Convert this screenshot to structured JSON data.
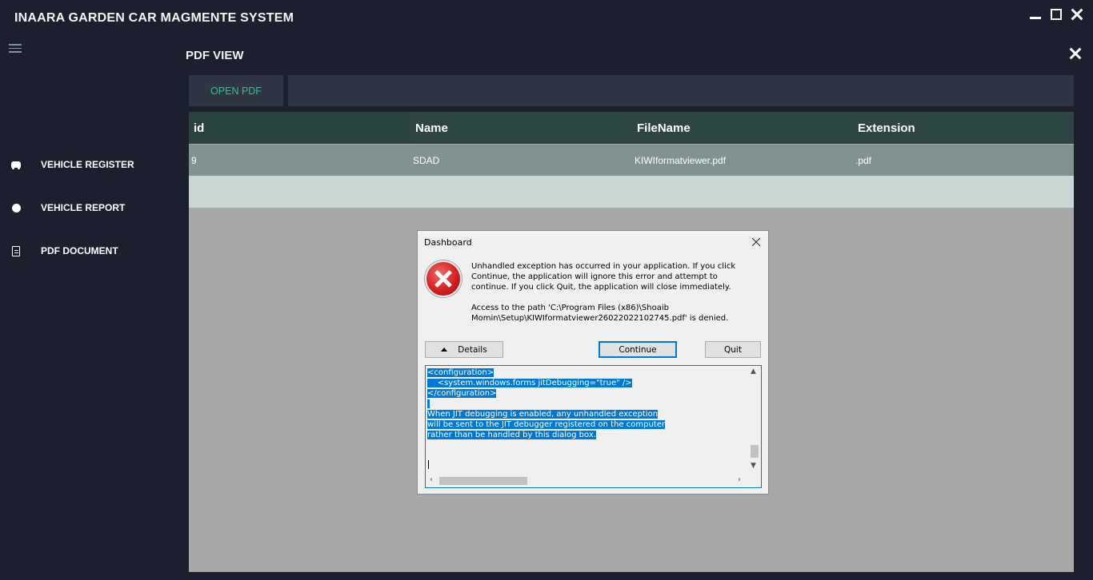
{
  "app": {
    "title": "INAARA GARDEN CAR MAGMENTE SYSTEM"
  },
  "sidebar": {
    "items": [
      {
        "label": "VEHICLE REGISTER",
        "icon": "car-icon"
      },
      {
        "label": "VEHICLE REPORT",
        "icon": "circle-icon"
      },
      {
        "label": "PDF DOCUMENT",
        "icon": "document-icon"
      }
    ]
  },
  "main": {
    "title": "PDF VIEW",
    "open_button": "OPEN PDF",
    "path_value": "",
    "table": {
      "columns": [
        "id",
        "Name",
        "FileName",
        "Extension"
      ],
      "rows": [
        [
          "9",
          "SDAD",
          "KIWIformatviewer.pdf",
          ".pdf"
        ]
      ]
    }
  },
  "dialog": {
    "title": "Dashboard",
    "message": "Unhandled exception has occurred in your application. If you click Continue, the application will ignore this error and attempt to continue. If you click Quit, the application will close immediately.",
    "detail": "Access to the path 'C:\\Program Files (x86)\\Shoaib Momin\\Setup\\KIWIformatviewer26022022102745.pdf' is denied.",
    "buttons": {
      "details": "Details",
      "continue": "Continue",
      "quit": "Quit"
    },
    "details_text": {
      "l1": "<configuration>",
      "l2": "    <system.windows.forms jitDebugging=\"true\" />",
      "l3": "</configuration>",
      "l4": "When JIT debugging is enabled, any unhandled exception",
      "l5": "will be sent to the JIT debugger registered on the computer",
      "l6": "rather than be handled by this dialog box."
    }
  },
  "colors": {
    "background": "#1b1f2e",
    "accent": "#23c98e",
    "header": "#2d4644",
    "row": "#809390",
    "selection": "#0078d7"
  }
}
